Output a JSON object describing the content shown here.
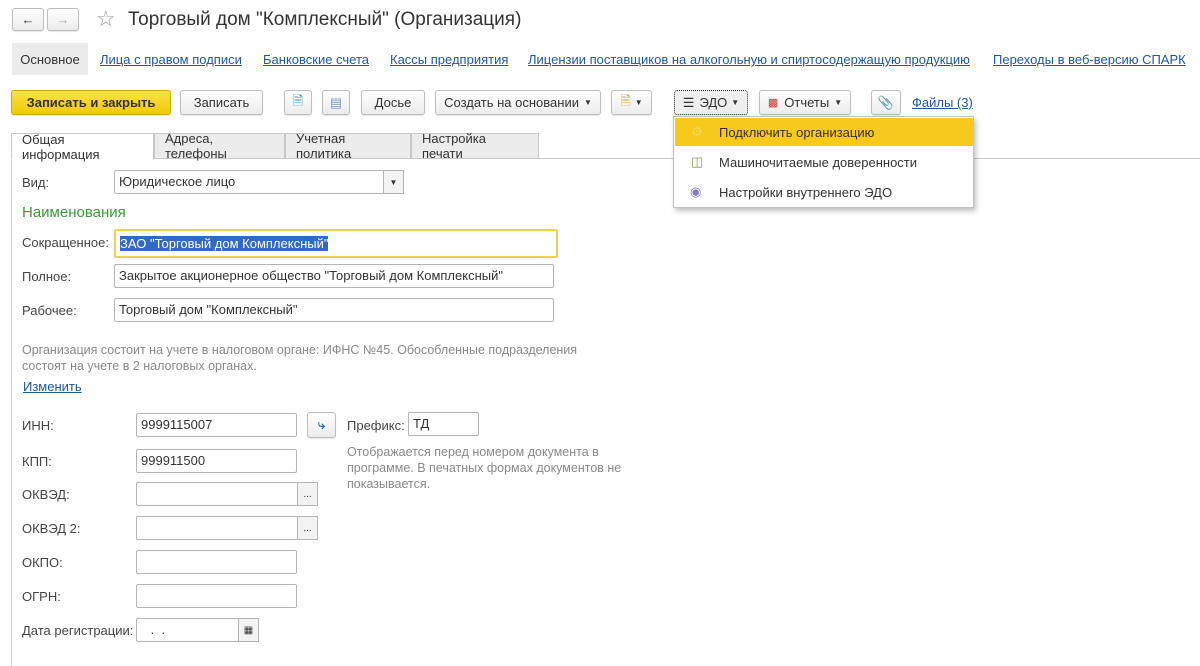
{
  "title": "Торговый дом \"Комплексный\" (Организация)",
  "nav": [
    "Основное",
    "Лица с правом подписи",
    "Банковские счета",
    "Кассы предприятия",
    "Лицензии поставщиков на алкогольную и спиртосодержащую продукцию",
    "Переходы в веб-версию СПАРК"
  ],
  "toolbar": {
    "save_close": "Записать и закрыть",
    "save": "Записать",
    "dossier": "Досье",
    "create_based": "Создать на основании",
    "edo": "ЭДО",
    "reports": "Отчеты",
    "files": "Файлы (3)"
  },
  "edo_menu": [
    "Подключить организацию",
    "Машиночитаемые доверенности",
    "Настройки внутреннего ЭДО"
  ],
  "tabs": [
    "Общая информация",
    "Адреса, телефоны",
    "Учетная политика",
    "Настройка печати"
  ],
  "form": {
    "vid_label": "Вид:",
    "vid_value": "Юридическое лицо",
    "names_heading": "Наименования",
    "short_label": "Сокращенное:",
    "short_value": "ЗАО \"Торговый дом Комплексный\"",
    "full_label": "Полное:",
    "full_value": "Закрытое акционерное общество \"Торговый дом Комплексный\"",
    "work_label": "Рабочее:",
    "work_value": "Торговый дом \"Комплексный\"",
    "tax_note_1": "Организация состоит на учете в налоговом органе: ИФНС №45. Обособленные подразделения",
    "tax_note_2": "состоят на учете в 2 налоговых органах.",
    "change_link": "Изменить",
    "inn_label": "ИНН:",
    "inn_value": "9999115007",
    "prefix_label": "Префикс:",
    "prefix_value": "ТД",
    "prefix_note_1": "Отображается перед номером документа в",
    "prefix_note_2": "программе. В печатных формах документов не",
    "prefix_note_3": "показывается.",
    "kpp_label": "КПП:",
    "kpp_value": "999911500",
    "okved_label": "ОКВЭД:",
    "okved2_label": "ОКВЭД 2:",
    "okpo_label": "ОКПО:",
    "ogrn_label": "ОГРН:",
    "reg_date_label": "Дата регистрации:",
    "reg_date_value": " .  ."
  },
  "colors": {
    "accent": "#f5d214",
    "green": "#3a9a3a",
    "link": "#1e56a0"
  }
}
